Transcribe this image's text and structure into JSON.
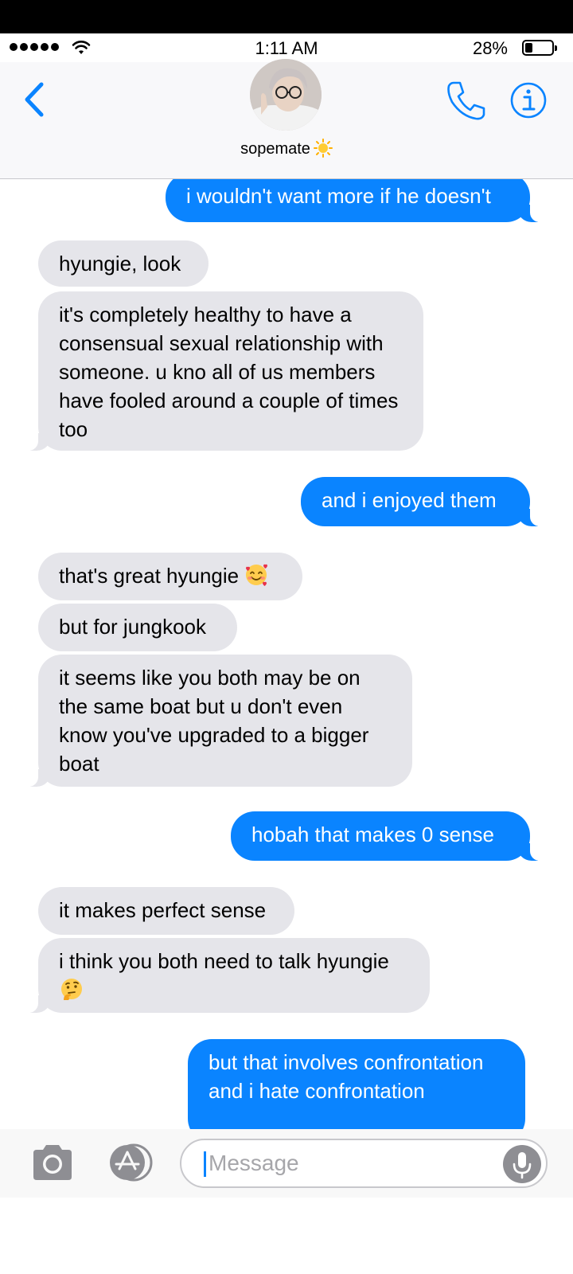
{
  "status_bar": {
    "time": "1:11 AM",
    "battery_percent": "28%",
    "battery_level": 0.28,
    "signal_bars": 5
  },
  "header": {
    "contact_name": "sopemate",
    "contact_emoji": "sun-emoji",
    "back_icon": "chevron-left-icon",
    "call_icon": "phone-icon",
    "info_icon": "info-icon"
  },
  "messages": [
    {
      "from": "me",
      "text": "i wouldn't want more if he doesn't"
    },
    {
      "from": "them",
      "text": "hyungie, look"
    },
    {
      "from": "them",
      "text": "it's completely healthy to have a consensual sexual relationship with someone. u kno all of us members have fooled around a couple of times too"
    },
    {
      "from": "me",
      "text": "and i enjoyed them"
    },
    {
      "from": "them",
      "text": "that's great hyungie",
      "emoji": "smiling-face-with-hearts-emoji"
    },
    {
      "from": "them",
      "text": "but for jungkook"
    },
    {
      "from": "them",
      "text": "it seems like you both may be on the same boat but u don't even know you've upgraded to a bigger boat"
    },
    {
      "from": "me",
      "text": "hobah that makes 0 sense"
    },
    {
      "from": "them",
      "text": "it makes perfect sense"
    },
    {
      "from": "them",
      "text": "i think you both need to talk hyungie",
      "emoji": "thinking-face-emoji"
    },
    {
      "from": "me",
      "text": "but that involves confrontation and i hate confrontation"
    }
  ],
  "input_bar": {
    "placeholder": "Message",
    "value": "",
    "camera_icon": "camera-icon",
    "apps_icon": "app-store-icon",
    "mic_icon": "microphone-icon"
  },
  "colors": {
    "outgoing_bubble": "#0a84ff",
    "incoming_bubble": "#e5e5ea",
    "accent": "#0a84ff"
  }
}
